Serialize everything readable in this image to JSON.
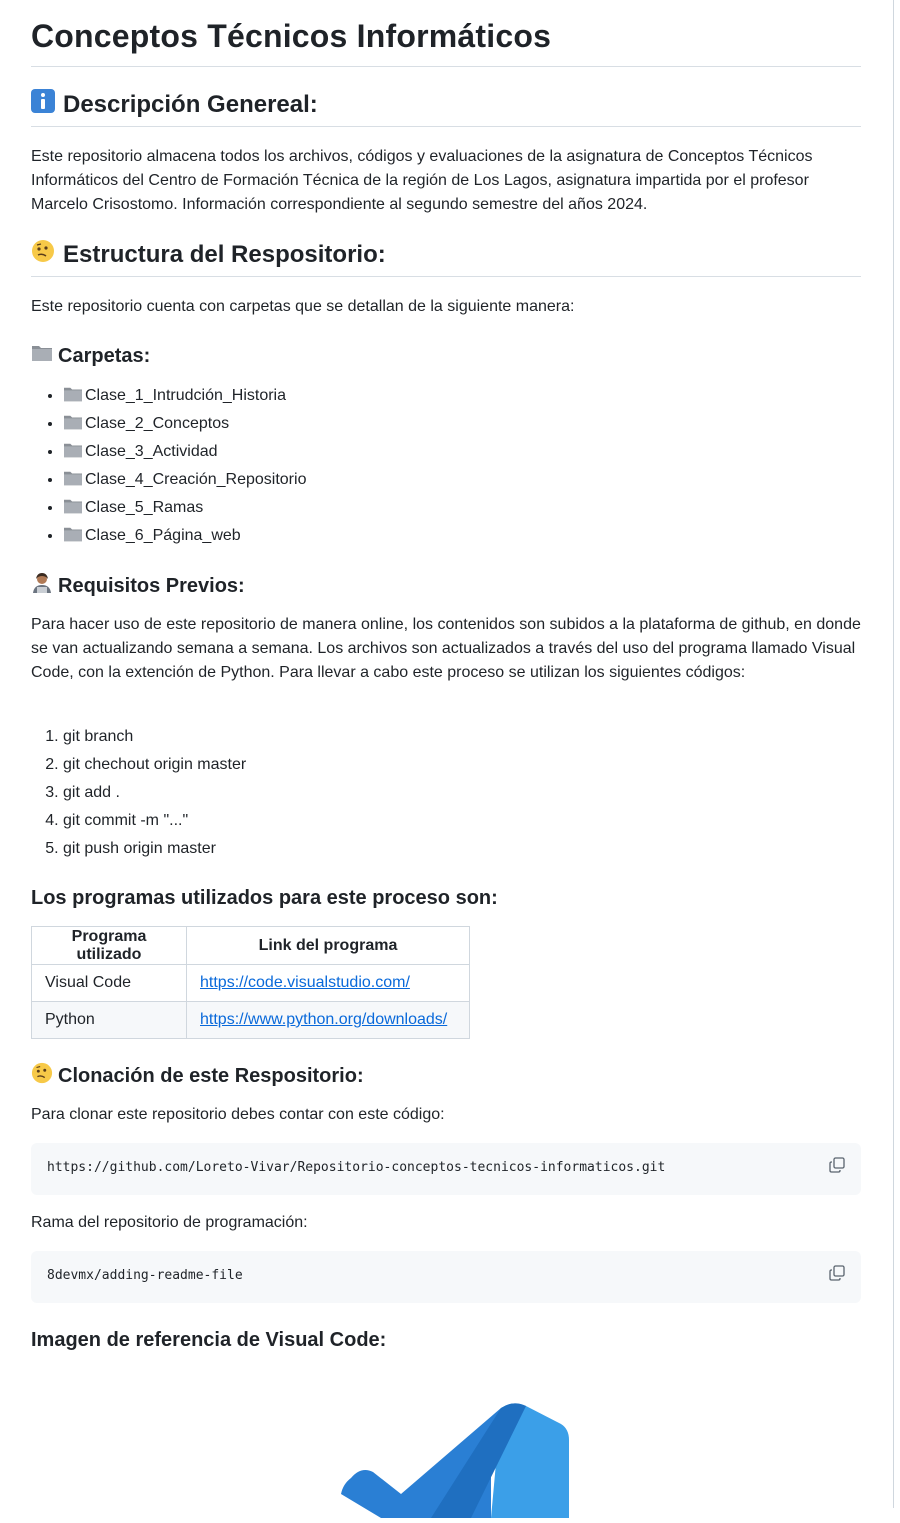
{
  "title": "Conceptos Técnicos Informáticos",
  "sections": {
    "description": {
      "icon": "information-icon",
      "heading": "Descripción Genereal:",
      "text": "Este repositorio almacena todos los archivos, códigos y evaluaciones de la asignatura de Conceptos Técnicos Informáticos del Centro de Formación Técnica de la región de Los Lagos, asignatura impartida por el profesor Marcelo Crisostomo. Información correspondiente al segundo semestre del años 2024."
    },
    "structure": {
      "icon": "thinking-face-icon",
      "heading": "Estructura del Respositorio:",
      "text": "Este repositorio cuenta con carpetas que se detallan de la siguiente manera:"
    },
    "folders": {
      "icon": "folder-icon",
      "heading": "Carpetas:",
      "items": [
        "Clase_1_Intrudción_Historia",
        "Clase_2_Conceptos",
        "Clase_3_Actividad",
        "Clase_4_Creación_Repositorio",
        "Clase_5_Ramas",
        "Clase_6_Página_web"
      ]
    },
    "requirements": {
      "icon": "technologist-icon",
      "heading": "Requisitos Previos:",
      "text": "Para hacer uso de este repositorio de manera online, los contenidos son subidos a la plataforma de github, en donde se van actualizando semana a semana. Los archivos son actualizados a través del uso del programa llamado Visual Code, con la extención de Python. Para llevar a cabo este proceso se utilizan los siguientes códigos:",
      "commands": [
        "git branch",
        "git chechout origin master",
        "git add .",
        "git commit -m \"...\"",
        "git push origin master"
      ]
    },
    "programs": {
      "heading": "Los programas utilizados para este proceso son:",
      "columns": [
        "Programa utilizado",
        "Link del programa"
      ],
      "rows": [
        {
          "name": "Visual Code",
          "link": "https://code.visualstudio.com/"
        },
        {
          "name": "Python",
          "link": "https://www.python.org/downloads/"
        }
      ]
    },
    "clone": {
      "icon": "thinking-face-icon",
      "heading": "Clonación de este Respositorio:",
      "text": "Para clonar este repositorio debes contar con este código:",
      "code": "https://github.com/Loreto-Vivar/Repositorio-conceptos-tecnicos-informaticos.git",
      "branch_text": "Rama del repositorio de programación:",
      "branch_code": "8devmx/adding-readme-file"
    },
    "reference": {
      "heading": "Imagen de referencia de Visual Code:",
      "image": "visual-studio-code-logo"
    }
  },
  "colors": {
    "link": "#0969da",
    "code_bg": "#f6f8fa",
    "border": "#d0d7de",
    "vscode_light": "#3b9fe8",
    "vscode_dark": "#1f6fc0"
  }
}
